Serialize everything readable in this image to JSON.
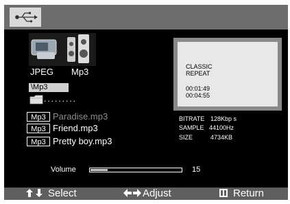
{
  "thumbnail_labels": {
    "jpeg": "JPEG",
    "mp3": "Mp3"
  },
  "path": "\\Mp3",
  "files": [
    {
      "badge": "Mp3",
      "name": "Paradise.mp3",
      "state": "dim"
    },
    {
      "badge": "Mp3",
      "name": "Friend.mp3",
      "state": "normal"
    },
    {
      "badge": "Mp3",
      "name": "Pretty boy.mp3",
      "state": "normal"
    }
  ],
  "info_panel": {
    "line1": "CLASSIC",
    "line2": "REPEAT",
    "elapsed": "00:01:49",
    "total": "00:04:55"
  },
  "meta": {
    "bitrate_label": "BITRATE",
    "bitrate": "128Kbp s",
    "sample_label": "SAMPLE",
    "sample": "44100Hz",
    "size_label": "SIZE",
    "size": "4734KB"
  },
  "volume": {
    "label": "Volume",
    "value": "15",
    "fraction": 0.19
  },
  "bottom_bar": {
    "select": "Select",
    "adjust": "Adjust",
    "return": "Return"
  },
  "icons": {
    "usb": "usb-icon",
    "folder": "folder-icon",
    "updown": "up-down-arrows-icon",
    "leftright": "left-right-arrows-icon",
    "return": "return-icon"
  }
}
